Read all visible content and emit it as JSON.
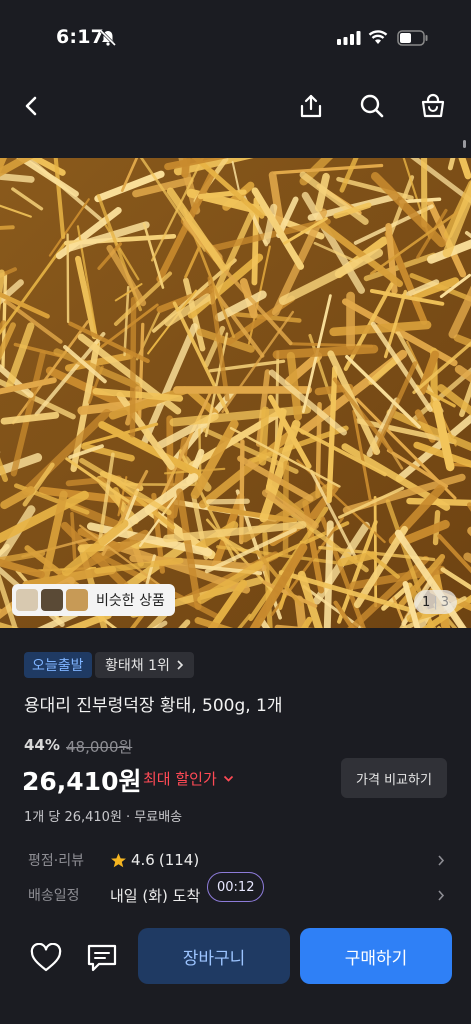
{
  "status_bar": {
    "time": "6:17"
  },
  "nav": {
    "back_icon": "chevron-left-icon",
    "share_icon": "share-icon",
    "search_icon": "search-icon",
    "bag_icon": "shopping-bag-icon"
  },
  "hero": {
    "similar_label": "비슷한 상품",
    "page_current": "1",
    "page_total": "3"
  },
  "product": {
    "badge_today": "오늘출발",
    "badge_rank": "황태채 1위",
    "title": "용대리 진부령덕장 황태, 500g, 1개",
    "discount_rate": "44%",
    "original_price": "48,000원",
    "sale_price": "26,410원",
    "max_discount": "최대 할인가",
    "compare_button": "가격 비교하기",
    "unit_info": "1개 당 26,410원 · 무료배송"
  },
  "rows": {
    "rating_label": "평점·리뷰",
    "rating_value": "4.6",
    "rating_count": "(114)",
    "delivery_label": "배송일정",
    "delivery_value": "내일 (화) 도착",
    "timer": "00:12"
  },
  "bottom": {
    "wish_icon": "heart-icon",
    "chat_icon": "chat-icon",
    "cart_label": "장바구니",
    "buy_label": "구매하기"
  },
  "colors": {
    "background": "#1b1c22",
    "accent_blue": "#2f80f6",
    "discount_red": "#ff4a55",
    "star": "#f5b521"
  }
}
